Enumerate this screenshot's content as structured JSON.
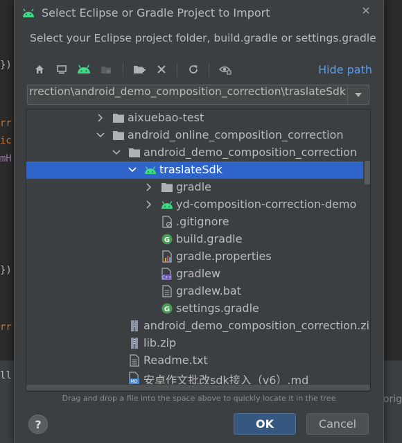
{
  "dialog": {
    "title": "Select Eclipse or Gradle Project to Import",
    "subtitle": "Select your Eclipse project folder, build.gradle or settings.gradle",
    "hide_path": "Hide path",
    "path_value": "rrection\\android_demo_composition_correction\\traslateSdk",
    "hint": "Drag and drop a file into the space above to quickly locate it in the tree",
    "help": "?",
    "ok": "OK",
    "cancel": "Cancel"
  },
  "tree": {
    "rows": [
      {
        "label": "aixuebao-test"
      },
      {
        "label": "android_online_composition_correction"
      },
      {
        "label": "android_demo_composition_correction"
      },
      {
        "label": "traslateSdk"
      },
      {
        "label": "gradle"
      },
      {
        "label": "yd-composition-correction-demo"
      },
      {
        "label": ".gitignore"
      },
      {
        "label": "build.gradle"
      },
      {
        "label": "gradle.properties"
      },
      {
        "label": "gradlew"
      },
      {
        "label": "gradlew.bat"
      },
      {
        "label": "settings.gradle"
      },
      {
        "label": "android_demo_composition_correction.zip"
      },
      {
        "label": "lib.zip"
      },
      {
        "label": "Readme.txt"
      },
      {
        "label": "安卓作文批改sdk接入（v6）.md"
      }
    ]
  },
  "background": {
    "code_fragments": [
      "})",
      "rr",
      "ic",
      "mH",
      "})",
      "rr",
      "ll"
    ],
    "side_text": "orig"
  },
  "colors": {
    "dialog_bg": "#3c3f41",
    "selection": "#2f65ca",
    "link": "#589df6",
    "android_green": "#3ddc84",
    "ok_button": "#365880"
  }
}
